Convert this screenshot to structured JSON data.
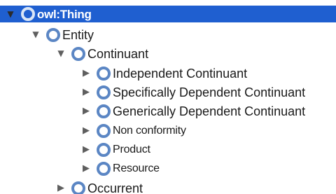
{
  "tree": {
    "root": {
      "label": "owl:Thing",
      "state": "expanded"
    },
    "entity": {
      "label": "Entity",
      "state": "expanded"
    },
    "continuant": {
      "label": "Continuant",
      "state": "expanded"
    },
    "children": [
      {
        "label": "Independent Continuant",
        "state": "collapsed"
      },
      {
        "label": "Specifically Dependent Continuant",
        "state": "collapsed"
      },
      {
        "label": "Generically Dependent Continuant",
        "state": "collapsed"
      },
      {
        "label": "Non conformity",
        "state": "collapsed"
      },
      {
        "label": "Product",
        "state": "collapsed"
      },
      {
        "label": "Resource",
        "state": "collapsed"
      }
    ],
    "occurrent": {
      "label": "Occurrent",
      "state": "collapsed"
    }
  },
  "colors": {
    "selection": "#1f5fd0",
    "bullet": "#5b86c4"
  }
}
